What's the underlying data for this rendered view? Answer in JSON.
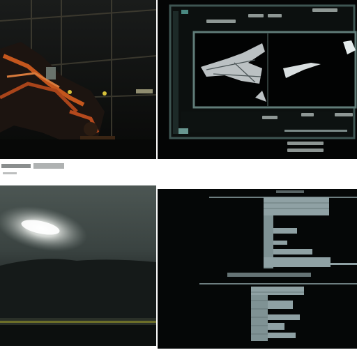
{
  "panels": [
    {
      "name": "robotic-machinery-photo"
    },
    {
      "name": "monitor-with-3d-model"
    },
    {
      "name": "night-sky-light-streak-photo"
    },
    {
      "name": "spreadsheet-screen-photo"
    }
  ],
  "colors": {
    "background": "#ffffff",
    "screen_bezel": "#5c7a77",
    "sky": "#3b4442",
    "cell": "#8fa1a4",
    "accent_orange": "#c4561d",
    "accent_yellow": "#c8b32d"
  }
}
